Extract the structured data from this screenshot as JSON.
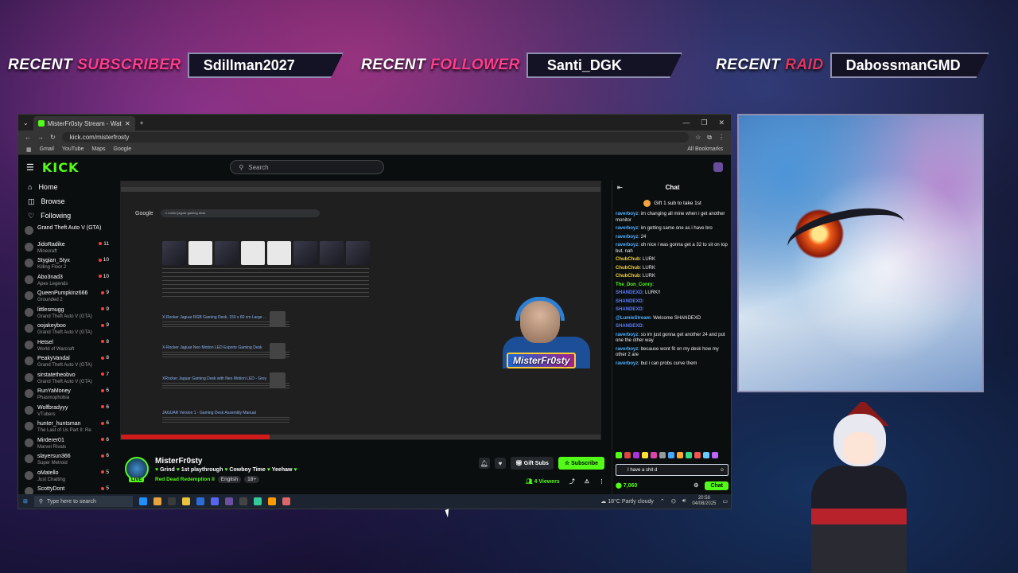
{
  "banner": {
    "subscriber": {
      "w1": "RECENT",
      "w2": "SUBSCRIBER",
      "name": "Sdillman2027"
    },
    "follower": {
      "w1": "RECENT",
      "w2": "FOLLOWER",
      "name": "Santi_DGK"
    },
    "raid": {
      "w1": "RECENT",
      "w2": "RAID",
      "name": "DabossmanGMD"
    }
  },
  "browser": {
    "tab_title": "MisterFr0sty Stream - Watc",
    "url": "kick.com/misterfrosty",
    "bookmarks": [
      "Gmail",
      "YouTube",
      "Maps",
      "Google"
    ],
    "all_bookmarks": "All Bookmarks"
  },
  "kick": {
    "logo": "KICK",
    "search_placeholder": "Search",
    "nav": [
      "Home",
      "Browse",
      "Following"
    ],
    "following": [
      {
        "name": "Grand Theft Auto V (GTA)",
        "game": "",
        "viewers": ""
      },
      {
        "name": "JidoRadike",
        "game": "Minecraft",
        "viewers": "11"
      },
      {
        "name": "Stygian_Styx",
        "game": "Killing Floor 2",
        "viewers": "10"
      },
      {
        "name": "Abo3nad3",
        "game": "Apex Legends",
        "viewers": "10"
      },
      {
        "name": "QueenPumpkinz666",
        "game": "Grounded 2",
        "viewers": "9"
      },
      {
        "name": "littlesmugg",
        "game": "Grand Theft Auto V (GTA)",
        "viewers": "9"
      },
      {
        "name": "oojakeyboo",
        "game": "Grand Theft Auto V (GTA)",
        "viewers": "9"
      },
      {
        "name": "Hetsel",
        "game": "World of Warcraft",
        "viewers": "8"
      },
      {
        "name": "PeakyVandal",
        "game": "Grand Theft Auto V (GTA)",
        "viewers": "8"
      },
      {
        "name": "sirstatetheobvo",
        "game": "Grand Theft Auto V (GTA)",
        "viewers": "7"
      },
      {
        "name": "RunYaMoney",
        "game": "Phasmophobia",
        "viewers": "6"
      },
      {
        "name": "Wolfbradyyy",
        "game": "VTubers",
        "viewers": "6"
      },
      {
        "name": "hunter_huntsman",
        "game": "The Last of Us Part II: Re",
        "viewers": "6"
      },
      {
        "name": "Mirderer01",
        "game": "Marvel Rivals",
        "viewers": "6"
      },
      {
        "name": "slayersun366",
        "game": "Super Metroid",
        "viewers": "6"
      },
      {
        "name": "oMatello",
        "game": "Just Chatting",
        "viewers": "5"
      },
      {
        "name": "ScottyDont",
        "game": "",
        "viewers": "5"
      }
    ]
  },
  "google": {
    "logo": "Google",
    "query": "x rocker jaguar gaming desk",
    "results": [
      "X-Rocker Jaguar RGB Gaming Desk, 150 x 60 cm Large ...",
      "X-Rocker Jaguar Neo Motion LED Esports Gaming Desk",
      "XRocker Jaguar Gaming Desk with Neo Motion LED - Grey",
      "JAGUAR Version 1 - Gaming Desk Assembly Manual"
    ],
    "progress": 0.31
  },
  "stream": {
    "overlay_name": "MisterFr0sty",
    "channel_name": "MisterFr0sty",
    "title_parts": [
      "Grind",
      "1st playthrough",
      "Cowboy Time",
      "Yeehaw"
    ],
    "category": "Red Dead Redemption II",
    "tags": [
      "English",
      "18+"
    ],
    "live": "LIVE",
    "gift_label": "Gift Subs",
    "subscribe_label": "Subscribe",
    "viewers": "4 Viewers"
  },
  "chat": {
    "header": "Chat",
    "pinned": "Gift 1 sub to take 1st",
    "messages": [
      {
        "user": "raverboyz",
        "color": "#4fb0ff",
        "text": "im changing all mine when i get another monitor"
      },
      {
        "user": "raverboyz",
        "color": "#4fb0ff",
        "text": "im getting same one as i have bro"
      },
      {
        "user": "raverboyz",
        "color": "#4fb0ff",
        "text": "24"
      },
      {
        "user": "raverboyz",
        "color": "#4fb0ff",
        "text": "oh nice i was gonna get a 32 to sit on top but. nah"
      },
      {
        "user": "ChubChub",
        "color": "#f2d13c",
        "text": "LURK"
      },
      {
        "user": "ChubChub",
        "color": "#f2d13c",
        "text": "LURK"
      },
      {
        "user": "ChubChub",
        "color": "#f2d13c",
        "text": "LURK"
      },
      {
        "user": "The_Don_Conry",
        "color": "#53fc18",
        "text": ""
      },
      {
        "user": "SHANDEXD",
        "color": "#5a7dff",
        "text": "LURK!!"
      },
      {
        "user": "SHANDEXD",
        "color": "#5a7dff",
        "text": ""
      },
      {
        "user": "SHANDEXD",
        "color": "#5a7dff",
        "text": ""
      },
      {
        "user": "@LumieStream",
        "color": "#4fb0ff",
        "text": "Welcome SHANDEXD"
      },
      {
        "user": "SHANDEXD",
        "color": "#5a7dff",
        "text": ""
      },
      {
        "user": "raverboyz",
        "color": "#4fb0ff",
        "text": "so im just gonna get another 24 and put one the other way"
      },
      {
        "user": "raverboyz",
        "color": "#4fb0ff",
        "text": "because wont fit on my desk how my other 2 are"
      },
      {
        "user": "raverboyz",
        "color": "#4fb0ff",
        "text": "but i can probs curve them"
      }
    ],
    "input_value": "I have a shit d",
    "points": "7,060",
    "send_label": "Chat"
  },
  "taskbar": {
    "search_placeholder": "Type here to search",
    "weather": "18°C  Partly cloudy",
    "time": "20:58",
    "date": "04/08/2025"
  },
  "colors": {
    "kick_green": "#53fc18",
    "accent_pink": "#ff3d8b",
    "raid_red": "#e0355d"
  }
}
